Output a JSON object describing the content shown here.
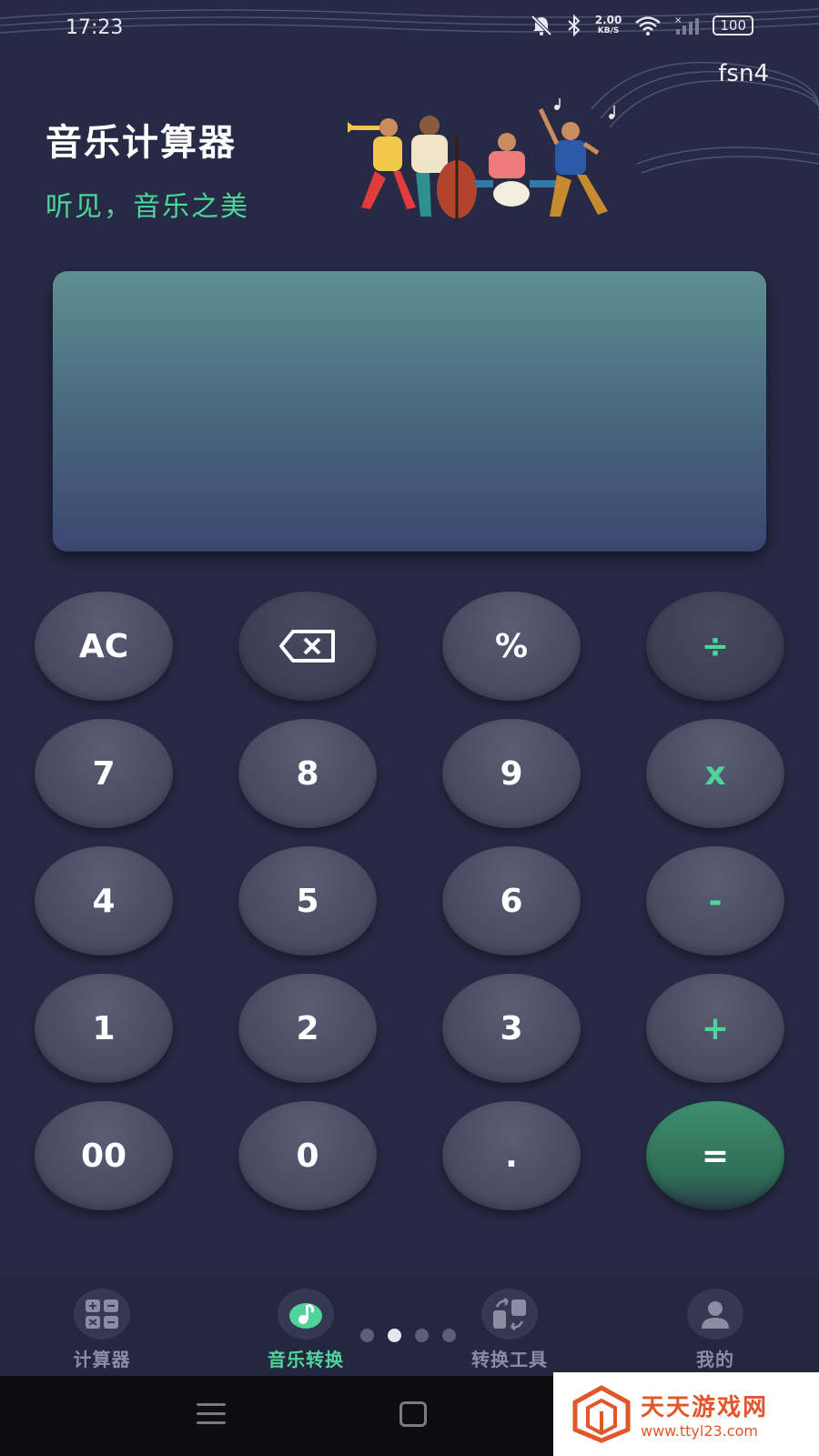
{
  "status_bar": {
    "time": "17:23",
    "net_speed_value": "2.00",
    "net_speed_unit": "KB/S",
    "battery": "100",
    "icons": [
      "mute-bell-icon",
      "bluetooth-icon",
      "wifi-icon",
      "signal-icon"
    ]
  },
  "header": {
    "user_name": "fsn4",
    "title": "音乐计算器",
    "subtitle": "听见，音乐之美"
  },
  "display": {
    "value": ""
  },
  "keypad": {
    "keys": [
      [
        "AC",
        "⌫",
        "%",
        "÷"
      ],
      [
        "7",
        "8",
        "9",
        "x"
      ],
      [
        "4",
        "5",
        "6",
        "-"
      ],
      [
        "1",
        "2",
        "3",
        "+"
      ],
      [
        "00",
        "0",
        ".",
        "="
      ]
    ]
  },
  "bottom_nav": {
    "items": [
      {
        "label": "计算器",
        "icon": "calculator-icon",
        "active": false
      },
      {
        "label": "音乐转换",
        "icon": "music-note-icon",
        "active": true
      },
      {
        "label": "转换工具",
        "icon": "convert-icon",
        "active": false
      },
      {
        "label": "我的",
        "icon": "profile-icon",
        "active": false
      }
    ],
    "page_indicator": {
      "count": 4,
      "active_index": 1
    }
  },
  "watermark": {
    "title": "天天游戏网",
    "url": "www.ttyl23.com"
  },
  "colors": {
    "background": "#262a45",
    "accent": "#4fd59a",
    "key": "#4a4d64",
    "equals_key": "#3f8f6e"
  }
}
